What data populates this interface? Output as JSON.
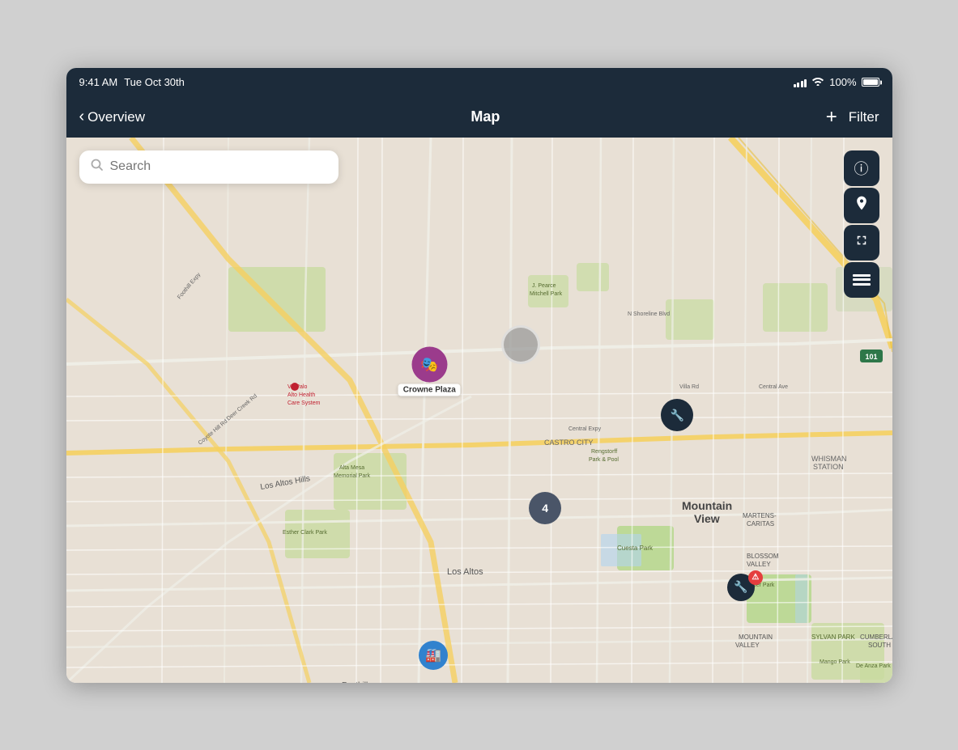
{
  "statusBar": {
    "time": "9:41 AM",
    "date": "Tue Oct 30th",
    "battery_percent": "100%"
  },
  "navBar": {
    "back_label": "Overview",
    "title": "Map",
    "filter_label": "Filter",
    "plus_label": "+"
  },
  "search": {
    "placeholder": "Search"
  },
  "markers": {
    "cluster_4_label": "4",
    "crowne_plaza_label": "Crowne Plaza",
    "va_label": "VA Palo Alto Health Care System"
  },
  "mapControls": {
    "info_label": "ℹ",
    "location_label": "➤",
    "expand_label": "⤢"
  }
}
